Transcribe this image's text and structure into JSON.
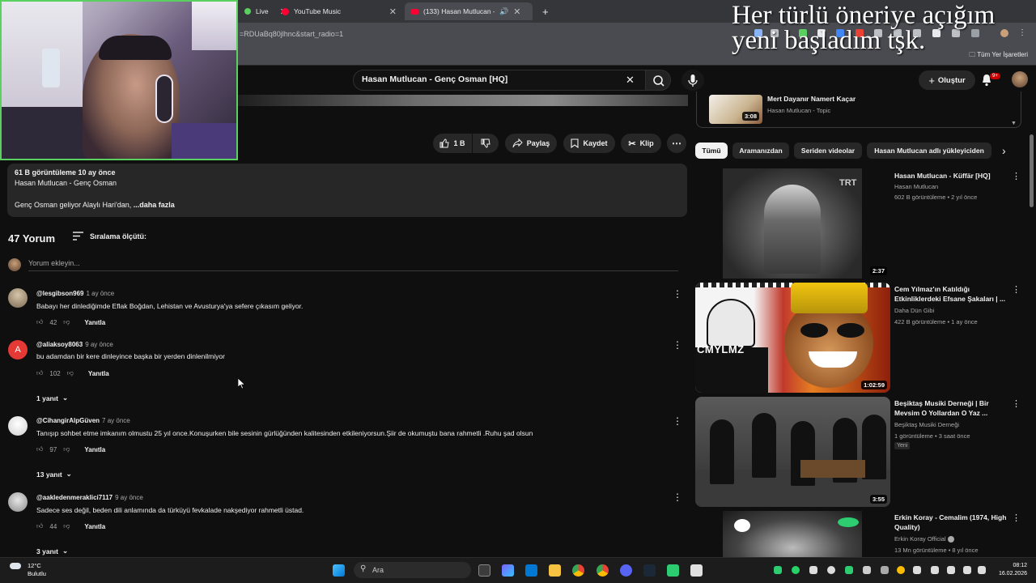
{
  "browser": {
    "tabs": [
      {
        "label": "Live",
        "icon": "youtube-live-icon"
      },
      {
        "label": "YouTube Music",
        "icon": "youtube-music-icon"
      },
      {
        "label": "(133) Hasan Mutlucan - Ge",
        "icon": "youtube-icon",
        "audio": true
      }
    ],
    "url": "=RDUaBq80jlhnc&start_radio=1",
    "bookmarks_label": "Tüm Yer İşaretleri"
  },
  "overlay": {
    "line1": "Her türlü öneriye açığım",
    "line2": "yeni başladım tşk."
  },
  "header": {
    "search_value": "Hasan Mutlucan - Genç Osman [HQ]",
    "create_label": "Oluştur",
    "notification_count": "9+"
  },
  "actions": {
    "like_count": "1 B",
    "share_label": "Paylaş",
    "save_label": "Kaydet",
    "clip_label": "Klip"
  },
  "description": {
    "stats": "61 B görüntüleme  10 ay önce",
    "title": "Hasan Mutlucan - Genç Osman",
    "text": "Genç Osman geliyor Alaylı Hari'dan,",
    "more": "...daha fazla"
  },
  "comments_section": {
    "count_label": "47 Yorum",
    "sort_label": "Sıralama ölçütü:",
    "add_placeholder": "Yorum ekleyin...",
    "reply_label": "Yanıtla",
    "comments": [
      {
        "author": "@lesgibson969",
        "when": "1 ay önce",
        "text": "Babayı her dinlediğimde Eflak Boğdan, Lehistan ve Avusturya'ya sefere çıkasım geliyor.",
        "likes": "42",
        "replies": ""
      },
      {
        "author": "@aliaksoy8063",
        "when": "9 ay önce",
        "text": "bu adamdan bir kere dinleyince başka bir yerden dinlenilmiyor",
        "likes": "102",
        "replies": "1 yanıt",
        "avatar_letter": "A"
      },
      {
        "author": "@CihangirAlpGüven",
        "when": "7 ay önce",
        "text": "Tanışıp sohbet etme imkanım olmustu 25 yıl once.Konuşurken bile sesinin gürlüğünden kalitesinden etkileniyorsun.Şiir de okumuştu bana rahmetli .Ruhu şad olsun",
        "likes": "97",
        "replies": "13 yanıt"
      },
      {
        "author": "@aakledenmeraklici7117",
        "when": "9 ay önce",
        "text": "Sadece ses değil, beden dili anlamında da türküyü fevkalade nakşediyor rahmetli üstad.",
        "likes": "44",
        "replies": "3 yanıt"
      }
    ]
  },
  "sidebar": {
    "mini_playlist": {
      "title": "Mert Dayanır Namert Kaçar",
      "channel": "Hasan Mutlucan - Topic",
      "duration": "3:08"
    },
    "chips": [
      "Tümü",
      "Aramanızdan",
      "Seriden videolar",
      "Hasan Mutlucan adlı yükleyiciden"
    ],
    "videos": [
      {
        "title": "Hasan Mutlucan - Küffär [HQ]",
        "channel": "Hasan Mutlucan",
        "meta": "602 B görüntüleme • 2 yıl önce",
        "duration": "2:37",
        "thumb_text": "TRT"
      },
      {
        "title": "Cem Yılmaz'ın Katıldığı Etkinliklerdeki Efsane Şakaları | ...",
        "channel": "Daha Dün Gibi",
        "meta": "422 B görüntüleme • 1 ay önce",
        "duration": "1:02:59",
        "thumb_text": "CMYLMZ"
      },
      {
        "title": "Beşiktaş Musiki Derneği | Bir Mevsim O Yollardan O Yaz ...",
        "channel": "Beşiktaş Musiki Derneği",
        "meta": "1 görüntüleme • 3 saat önce",
        "duration": "3:55",
        "badge": "Yeni"
      },
      {
        "title": "Erkin Koray - Cemalim (1974, High Quality)",
        "channel": "Erkin Koray Official",
        "meta": "13 Mn görüntüleme • 8 yıl önce",
        "duration": ""
      }
    ]
  },
  "taskbar": {
    "weather_temp": "12°C",
    "weather_desc": "Bulutlu",
    "search_label": "Ara",
    "time": "08:12",
    "date": "16.02.2026"
  },
  "colors": {
    "background": "#0f0f0f",
    "surface": "#272727",
    "webcam_border": "#59d05f",
    "youtube_red": "#ff0000"
  }
}
